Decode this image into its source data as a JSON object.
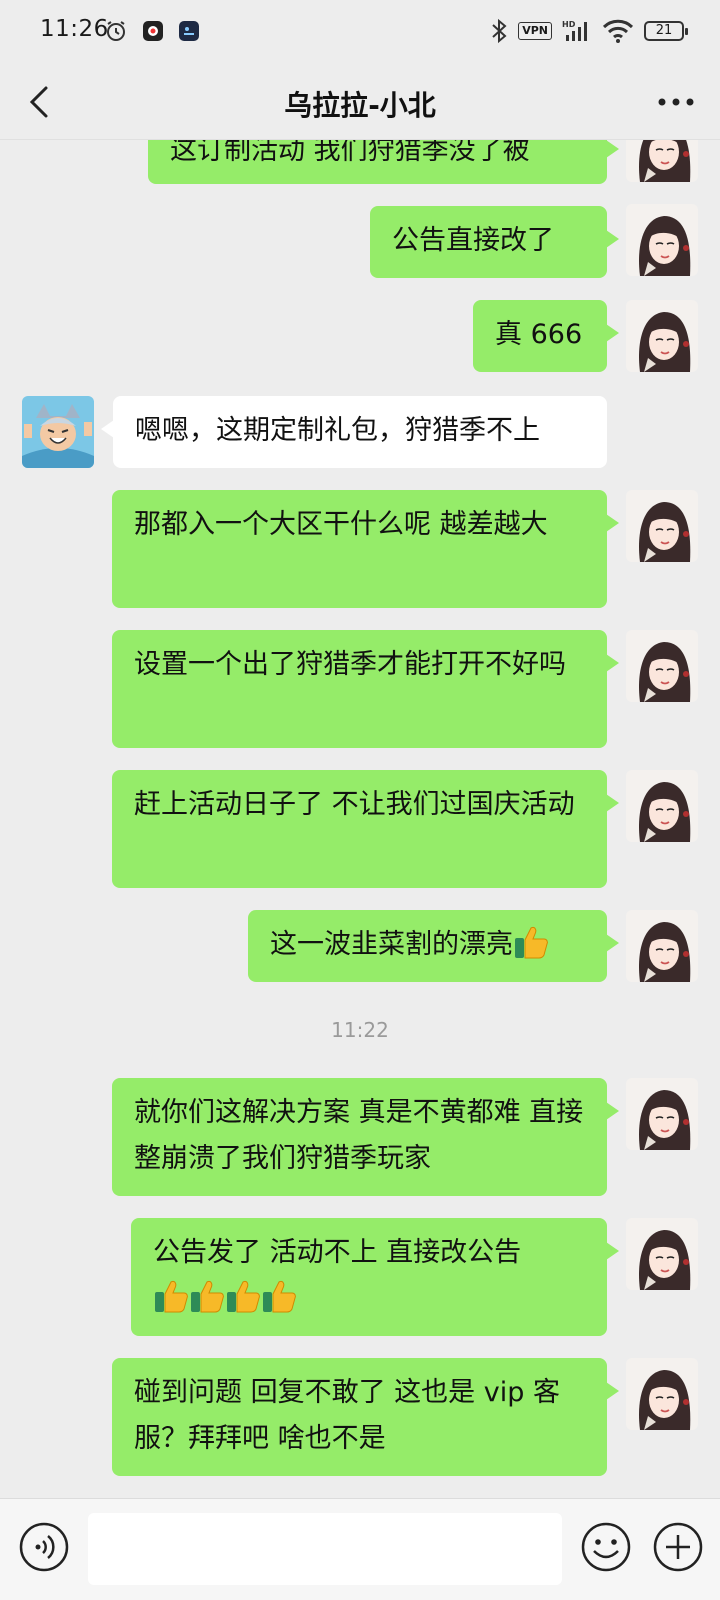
{
  "status_bar": {
    "time": "11:26",
    "vpn": "VPN",
    "battery": "21"
  },
  "header": {
    "title": "乌拉拉-小北"
  },
  "messages": [
    {
      "text": "这订制活动 我们狩猎季没了被"
    },
    {
      "text": "公告直接改了"
    },
    {
      "text": "真 666"
    },
    {
      "text": "嗯嗯，这期定制礼包，狩猎季不上"
    },
    {
      "text": "那都入一个大区干什么呢  越差越大"
    },
    {
      "text": "设置一个出了狩猎季才能打开不好吗"
    },
    {
      "text": "赶上活动日子了  不让我们过国庆活动"
    },
    {
      "text": "这一波韭菜割的漂亮"
    },
    {
      "text": "就你们这解决方案 真是不黄都难 直接整崩溃了我们狩猎季玩家"
    },
    {
      "text": "公告发了  活动不上  直接改公告"
    },
    {
      "text": "碰到问题 回复不敢了  这也是 vip 客服？拜拜吧  啥也不是"
    }
  ],
  "timestamp": "11:22",
  "colors": {
    "outgoing_bubble": "#95ec69",
    "incoming_bubble": "#ffffff",
    "background": "#ededed"
  }
}
